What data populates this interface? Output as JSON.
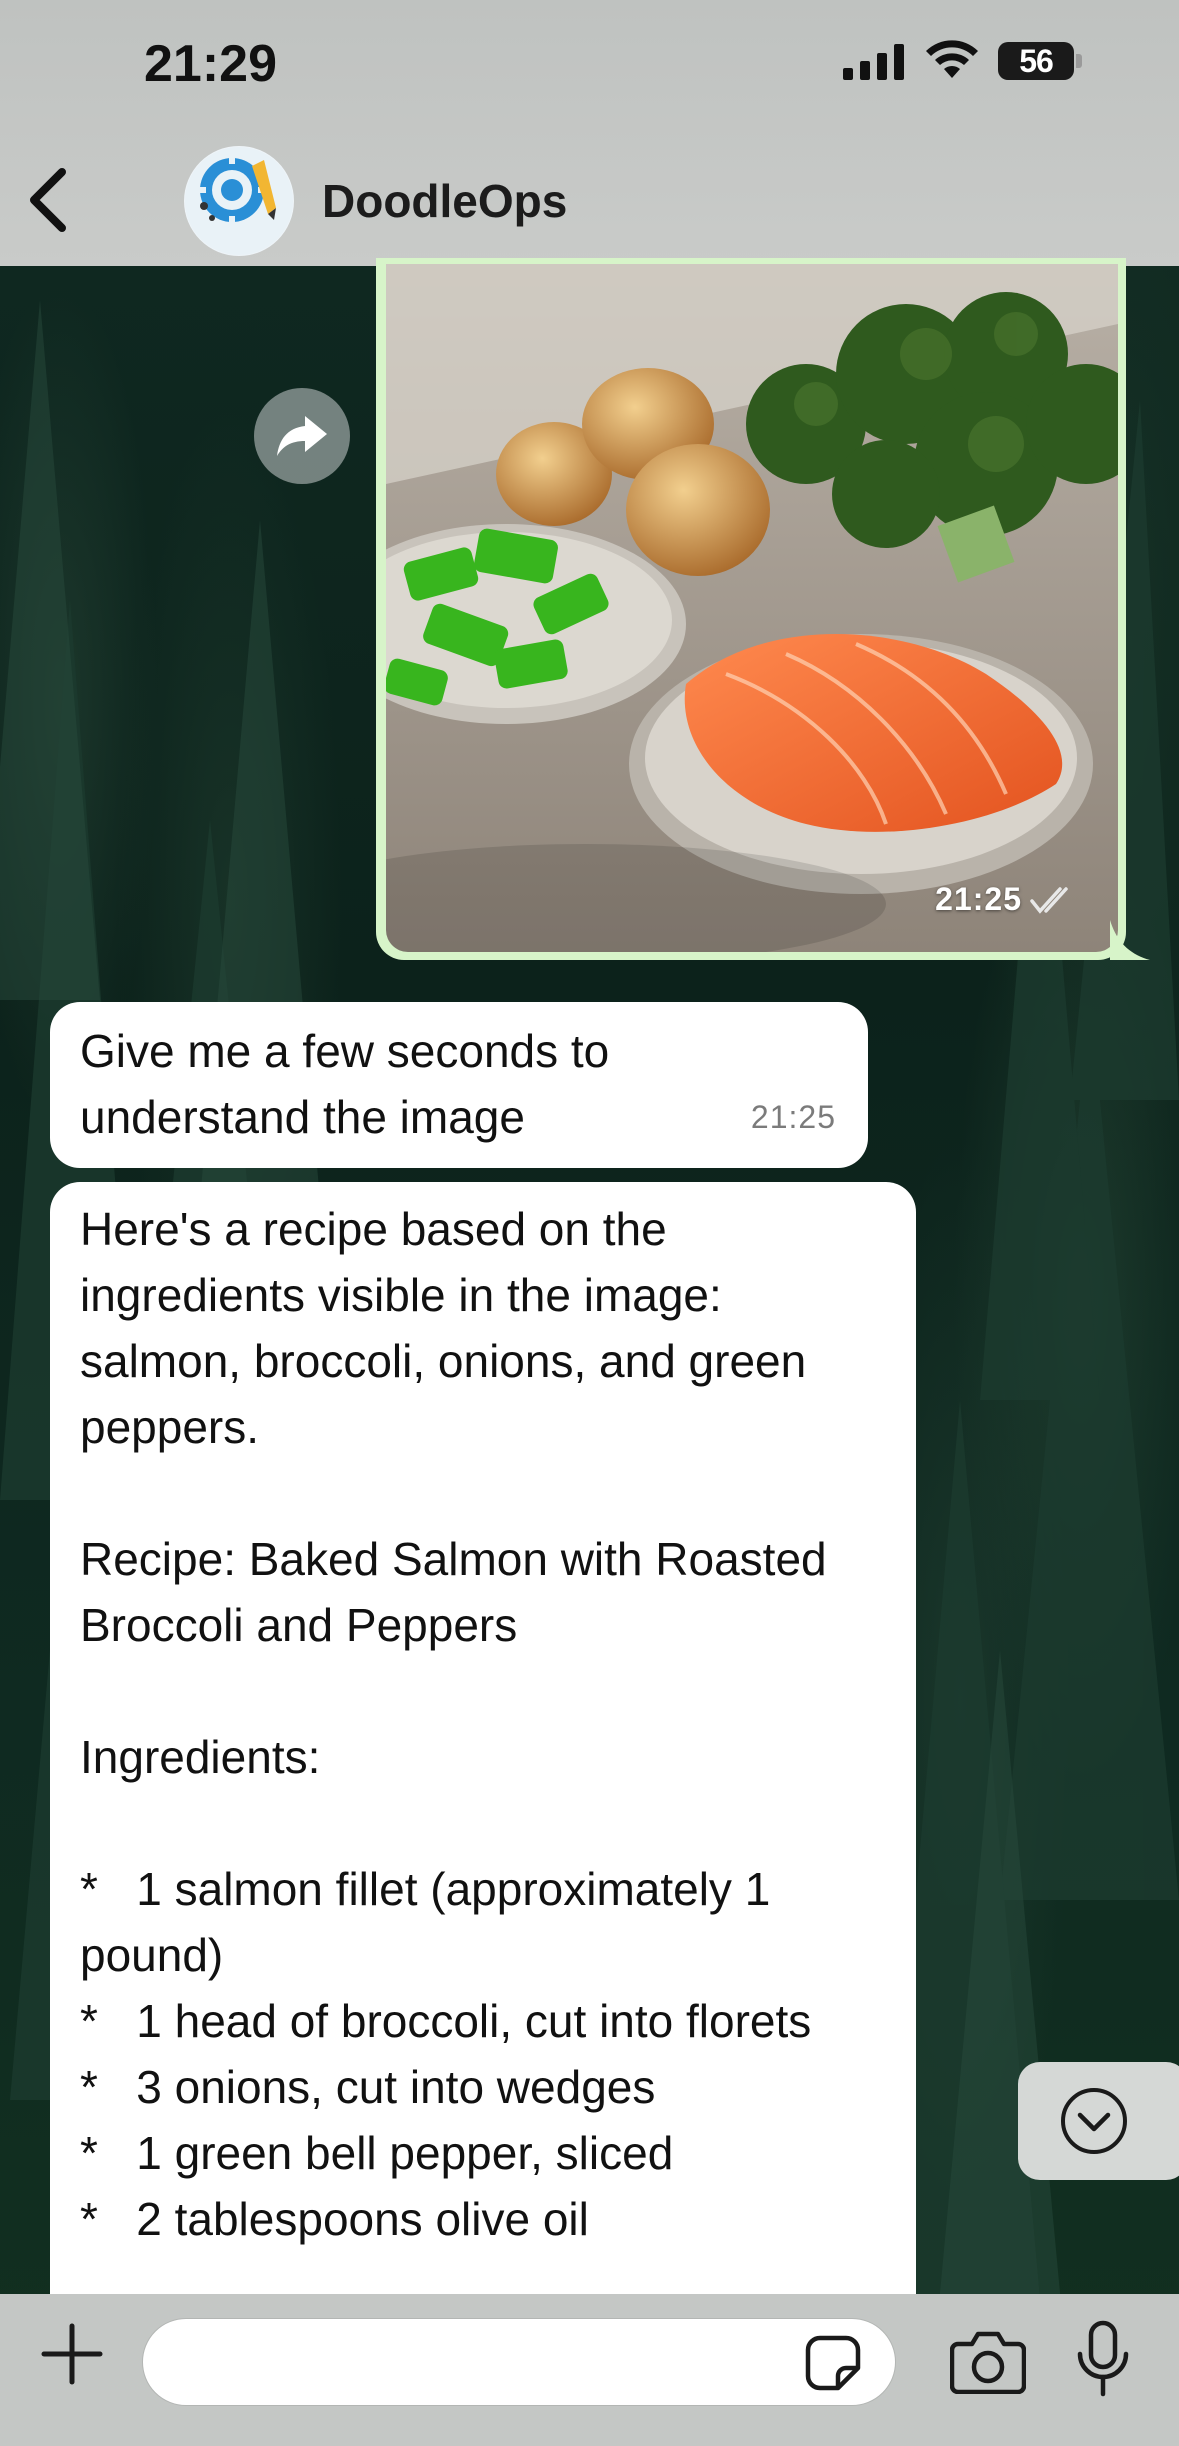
{
  "status_bar": {
    "time": "21:29",
    "battery": "56",
    "icons": [
      "signal-icon",
      "wifi-icon",
      "battery-icon"
    ]
  },
  "header": {
    "contact_name": "DoodleOps",
    "avatar_text": "DoodleOps",
    "icons": [
      "back-chevron-icon",
      "avatar-logo"
    ]
  },
  "messages": [
    {
      "type": "image",
      "direction": "outgoing",
      "time": "21:25",
      "status": "read",
      "icons": [
        "double-check-icon",
        "forward-icon"
      ]
    },
    {
      "type": "text",
      "direction": "incoming",
      "text": "Give me a few seconds to understand the image",
      "time": "21:25"
    },
    {
      "type": "text",
      "direction": "incoming",
      "lines": [
        "Here's a recipe based on the ingredients visible in the image: salmon, broccoli, onions, and green peppers.",
        "",
        "Recipe: Baked Salmon with Roasted Broccoli and Peppers",
        "",
        "Ingredients:",
        "",
        "*   1 salmon fillet (approximately 1 pound)",
        "*   1 head of broccoli, cut into florets",
        "*   3 onions, cut into wedges",
        "*   1 green bell pepper, sliced",
        "*   2 tablespoons olive oil"
      ]
    }
  ],
  "composer": {
    "placeholder": "",
    "icons": [
      "plus-icon",
      "sticker-icon",
      "camera-icon",
      "microphone-icon"
    ]
  },
  "scroll_button_icon": "chevron-down-circle-icon",
  "colors": {
    "outgoing_bubble": "#d7f4c9",
    "incoming_bubble": "#ffffff",
    "bars": "#c4c7c5"
  }
}
